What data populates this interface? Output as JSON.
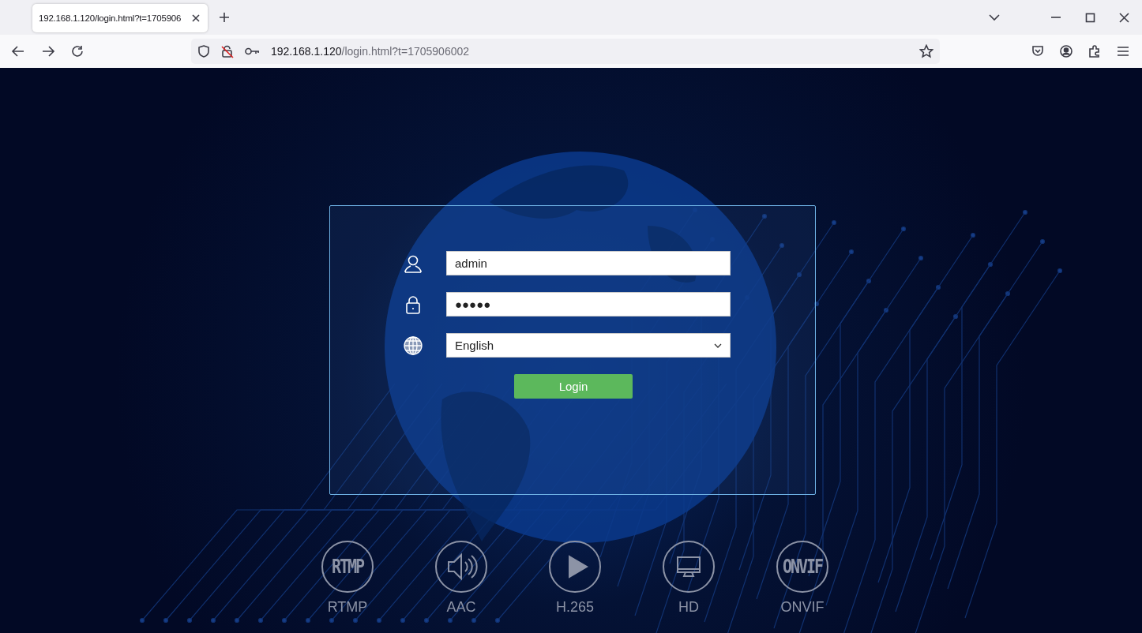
{
  "browser": {
    "tab": {
      "title": "192.168.1.120/login.html?t=1705906",
      "selected": true
    },
    "url": {
      "host": "192.168.1.120",
      "path": "/login.html?t=1705906002"
    }
  },
  "login": {
    "username": {
      "value": "admin"
    },
    "password": {
      "value": "●●●●●"
    },
    "language": {
      "value": "English"
    },
    "button": "Login"
  },
  "features": [
    {
      "kind": "text",
      "icon_text": "RTMP",
      "label": "RTMP"
    },
    {
      "kind": "speaker",
      "label": "AAC"
    },
    {
      "kind": "play",
      "label": "H.265"
    },
    {
      "kind": "monitor",
      "label": "HD"
    },
    {
      "kind": "text",
      "icon_text": "ONVIF",
      "label": "ONVIF"
    }
  ]
}
